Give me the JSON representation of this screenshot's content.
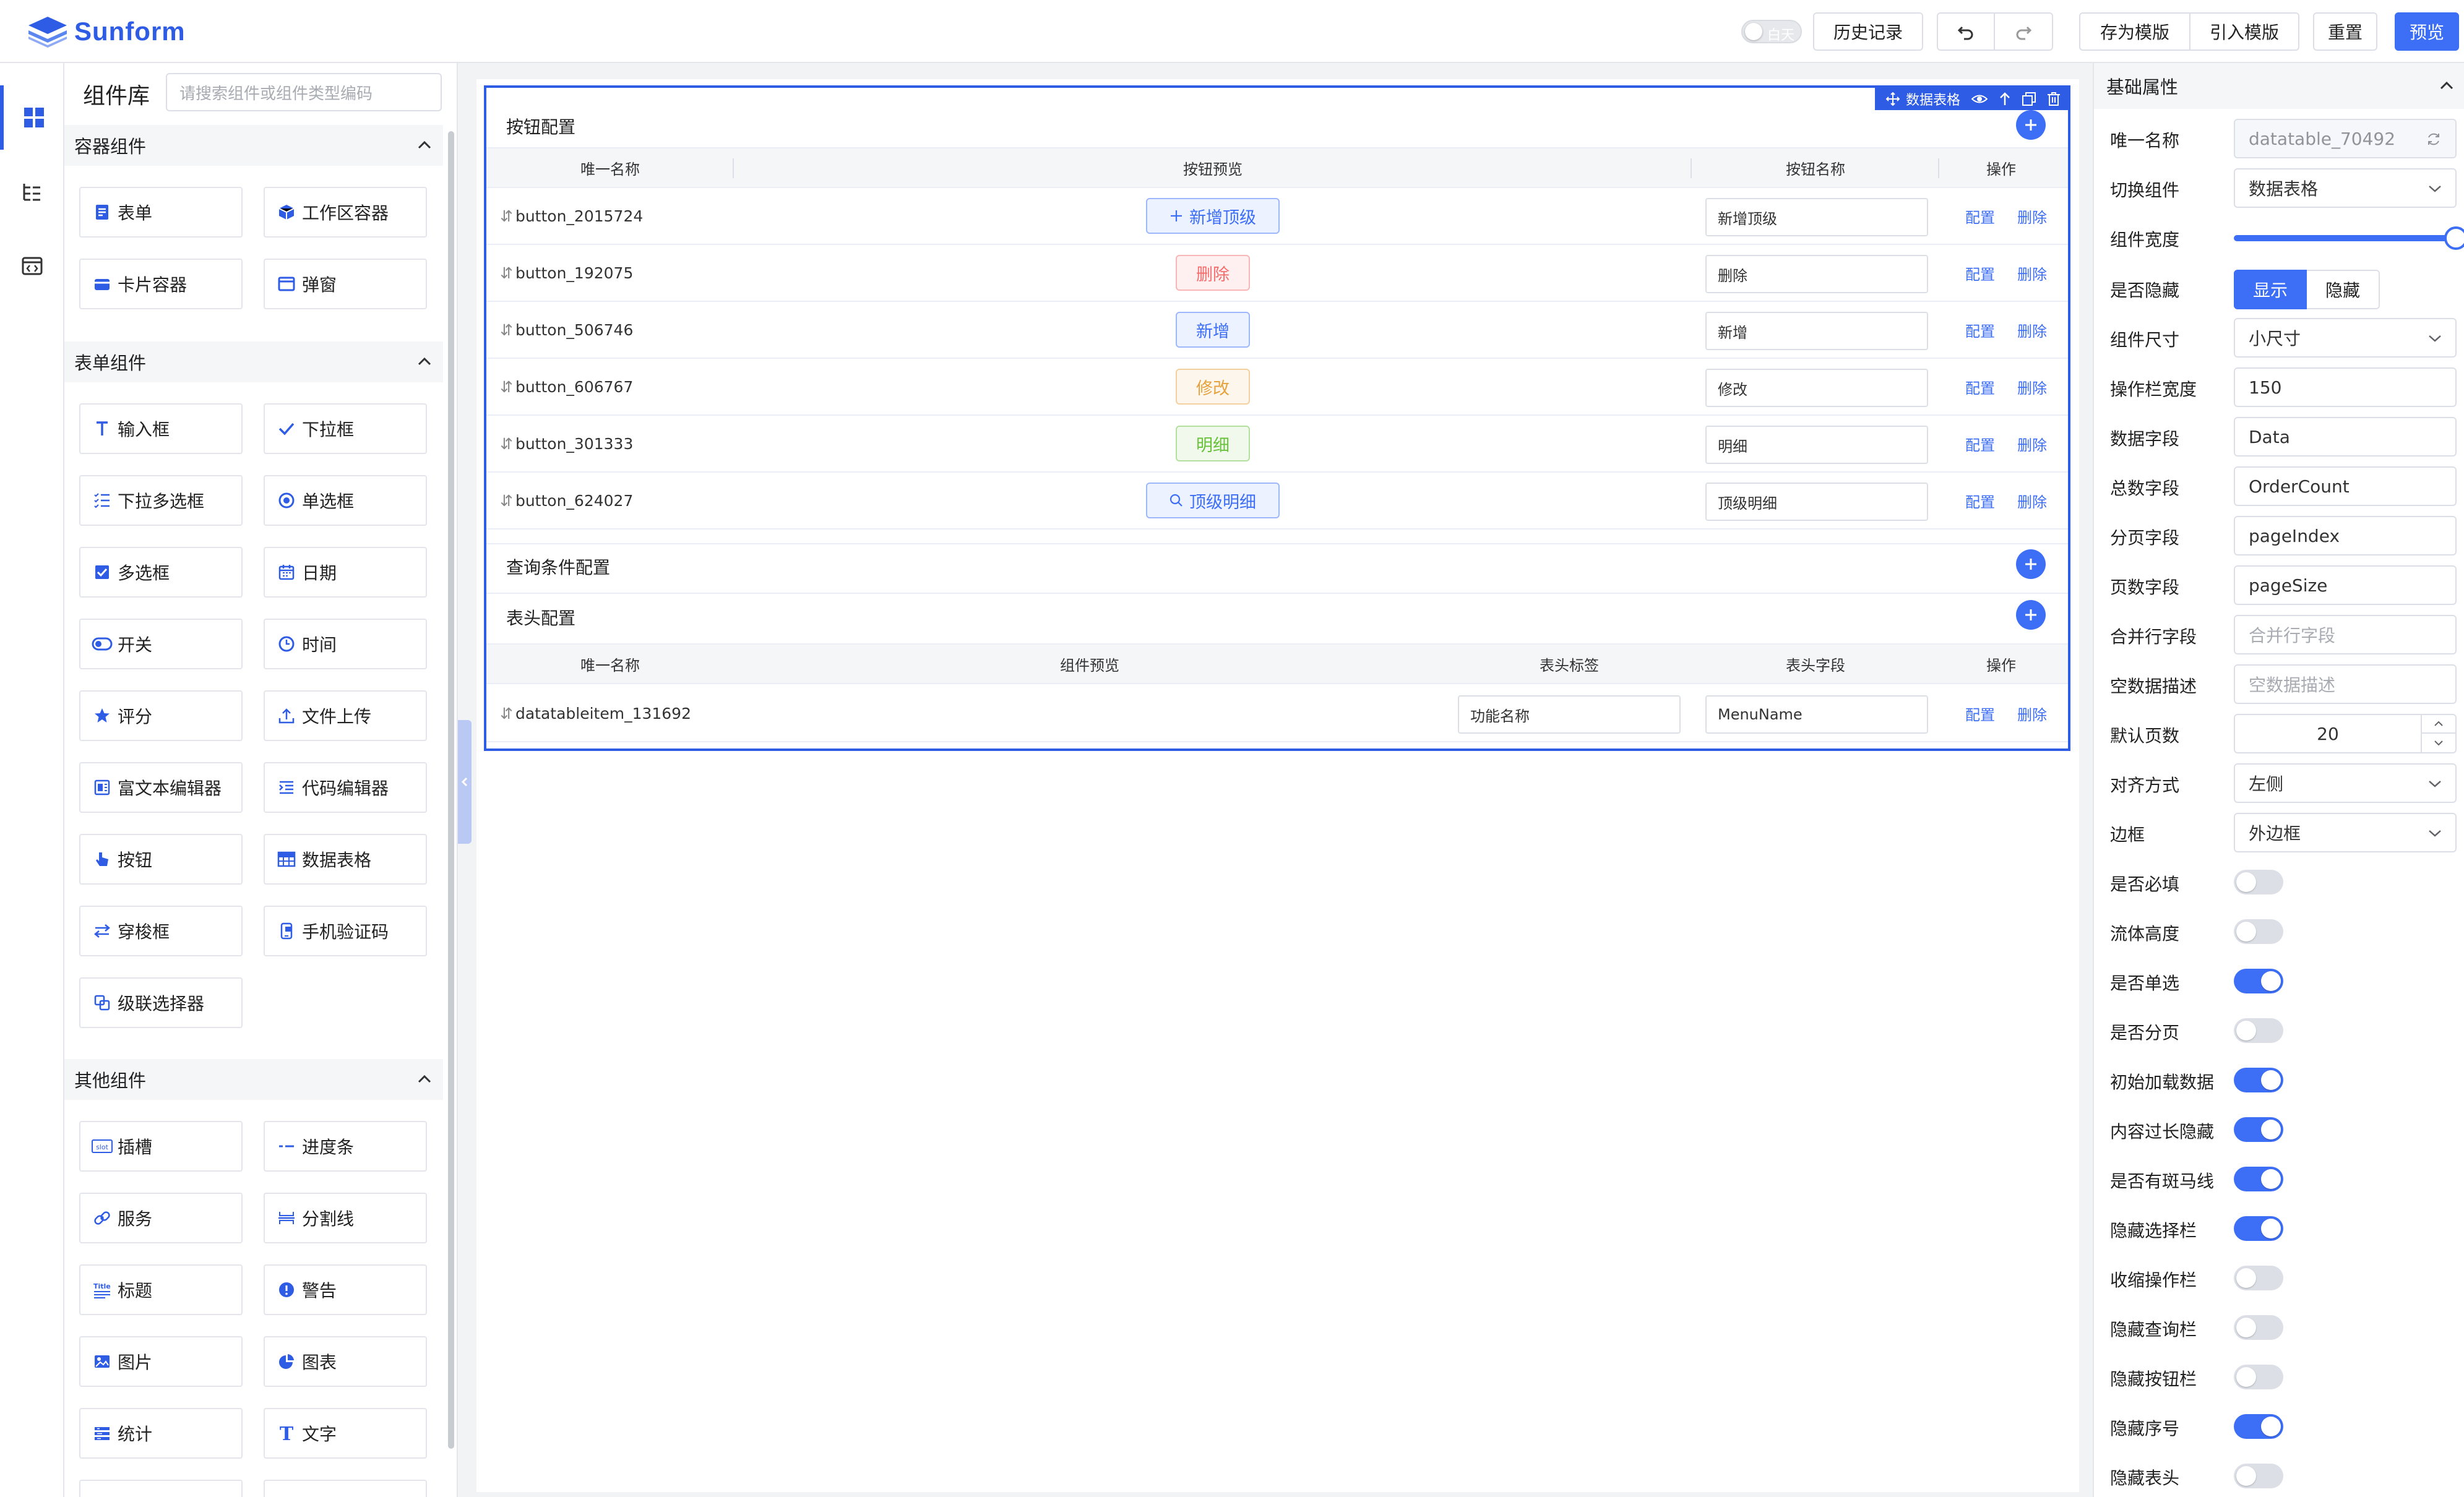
{
  "app": {
    "logo_text": "Sunform"
  },
  "topbar": {
    "theme_label": "白天",
    "history": "历史记录",
    "save_template": "存为模版",
    "import_template": "引入模版",
    "reset": "重置",
    "preview": "预览"
  },
  "library": {
    "title": "组件库",
    "search_placeholder": "请搜索组件或组件类型编码",
    "sections": [
      {
        "title": "容器组件",
        "items": [
          "表单",
          "工作区容器",
          "卡片容器",
          "弹窗"
        ]
      },
      {
        "title": "表单组件",
        "items": [
          "输入框",
          "下拉框",
          "下拉多选框",
          "单选框",
          "多选框",
          "日期",
          "开关",
          "时间",
          "评分",
          "文件上传",
          "富文本编辑器",
          "代码编辑器",
          "按钮",
          "数据表格",
          "穿梭框",
          "手机验证码",
          "级联选择器"
        ]
      },
      {
        "title": "其他组件",
        "items": [
          "插槽",
          "进度条",
          "服务",
          "分割线",
          "标题",
          "警告",
          "图片",
          "图表",
          "统计",
          "文字"
        ]
      }
    ]
  },
  "widget": {
    "toolbar_label": "数据表格",
    "button_section": {
      "title": "按钮配置",
      "headers": [
        "唯一名称",
        "按钮预览",
        "按钮名称",
        "操作"
      ],
      "rows": [
        {
          "uid": "button_2015724",
          "preview": "新增顶级",
          "name": "新增顶级",
          "style": "plain-primary",
          "icon": "plus"
        },
        {
          "uid": "button_192075",
          "preview": "删除",
          "name": "删除",
          "style": "danger"
        },
        {
          "uid": "button_506746",
          "preview": "新增",
          "name": "新增",
          "style": "primary"
        },
        {
          "uid": "button_606767",
          "preview": "修改",
          "name": "修改",
          "style": "warning"
        },
        {
          "uid": "button_301333",
          "preview": "明细",
          "name": "明细",
          "style": "success"
        },
        {
          "uid": "button_624027",
          "preview": "顶级明细",
          "name": "顶级明细",
          "style": "plain-primary",
          "icon": "search"
        }
      ]
    },
    "query_section": {
      "title": "查询条件配置"
    },
    "header_section": {
      "title": "表头配置",
      "headers": [
        "唯一名称",
        "组件预览",
        "表头标签",
        "表头字段",
        "操作"
      ],
      "rows": [
        {
          "uid": "datatableitem_131692",
          "label": "功能名称",
          "field": "MenuName"
        }
      ]
    },
    "actions": {
      "config": "配置",
      "delete": "删除"
    }
  },
  "props": {
    "title": "基础属性",
    "labels": {
      "unique_name": "唯一名称",
      "switch_component": "切换组件",
      "width": "组件宽度",
      "hidden": "是否隐藏",
      "size": "组件尺寸",
      "op_width": "操作栏宽度",
      "data_field": "数据字段",
      "total_field": "总数字段",
      "page_field": "分页字段",
      "pagesize_field": "页数字段",
      "merge_field": "合并行字段",
      "empty_desc": "空数据描述",
      "default_pagesize": "默认页数",
      "align": "对齐方式",
      "border": "边框",
      "required": "是否必填",
      "fluid_height": "流体高度",
      "single_select": "是否单选",
      "paging": "是否分页",
      "init_load": "初始加载数据",
      "overflow_hide": "内容过长隐藏",
      "stripe": "是否有斑马线",
      "hide_select": "隐藏选择栏",
      "collapse_op": "收缩操作栏",
      "hide_query": "隐藏查询栏",
      "hide_buttons": "隐藏按钮栏",
      "hide_index": "隐藏序号",
      "hide_header": "隐藏表头"
    },
    "values": {
      "unique_name": "datatable_70492",
      "switch_component": "数据表格",
      "width_percent": 100,
      "hidden_show": "显示",
      "hidden_hide": "隐藏",
      "size": "小尺寸",
      "op_width": "150",
      "data_field": "Data",
      "total_field": "OrderCount",
      "page_field": "pageIndex",
      "pagesize_field": "pageSize",
      "merge_placeholder": "合并行字段",
      "empty_placeholder": "空数据描述",
      "default_pagesize": "20",
      "align": "左侧",
      "border": "外边框"
    },
    "switches": {
      "required": false,
      "fluid_height": false,
      "single_select": true,
      "paging": false,
      "init_load": true,
      "overflow_hide": true,
      "stripe": true,
      "hide_select": true,
      "collapse_op": false,
      "hide_query": false,
      "hide_buttons": false,
      "hide_index": true,
      "hide_header": false
    }
  },
  "colors": {
    "primary": "#3d6ef6",
    "danger": "#f56c6c",
    "warning": "#e6a23c",
    "success": "#67c23a"
  }
}
